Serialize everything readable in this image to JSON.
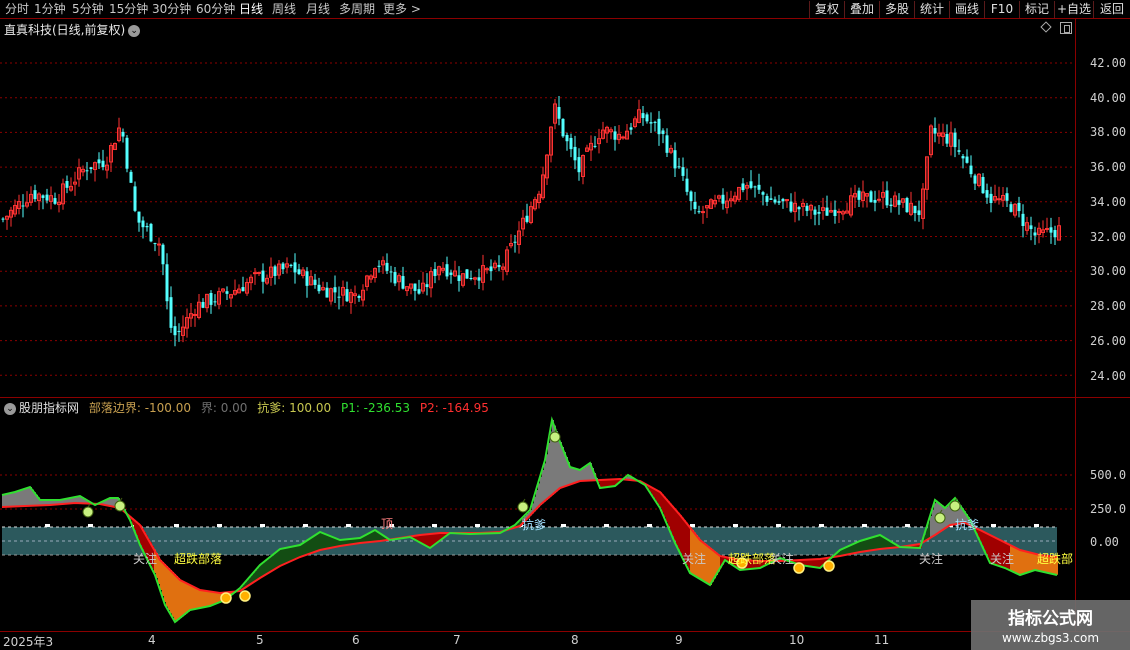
{
  "toolbar": {
    "periods": [
      "分时",
      "1分钟",
      "5分钟",
      "15分钟",
      "30分钟",
      "60分钟",
      "日线",
      "周线",
      "月线",
      "多周期",
      "更多 >"
    ],
    "active_period": "日线",
    "buttons": [
      "复权",
      "叠加",
      "多股",
      "统计",
      "画线",
      "F10",
      "标记",
      "+自选",
      "返回"
    ]
  },
  "stock": {
    "title": "直真科技(日线,前复权)"
  },
  "price_axis": [
    "42.00",
    "40.00",
    "38.00",
    "36.00",
    "34.00",
    "32.00",
    "30.00",
    "28.00",
    "26.00",
    "24.00"
  ],
  "indicator": {
    "name": "股朋指标网",
    "legend": [
      {
        "text": "部落边界: -100.00",
        "color": "#c8a050"
      },
      {
        "text": "界: 0.00",
        "color": "#707070"
      },
      {
        "text": "抗爹: 100.00",
        "color": "#c8c850"
      },
      {
        "text": "P1: -236.53",
        "color": "#30e030"
      },
      {
        "text": "P2: -164.95",
        "color": "#ff3030"
      }
    ],
    "axis": [
      "500.0",
      "250.0",
      "0.00"
    ],
    "annotations": [
      {
        "text": "关注",
        "color": "#ffffff"
      },
      {
        "text": "超跌部落",
        "color": "#ffff40"
      },
      {
        "text": "顶",
        "color": "#ff8080"
      },
      {
        "text": "抗爹",
        "color": "#a0e0ff"
      },
      {
        "text": "关注",
        "color": "#ffffff"
      },
      {
        "text": "超跌部落",
        "color": "#ffff40"
      },
      {
        "text": "关注",
        "color": "#ffffff"
      },
      {
        "text": "关注",
        "color": "#ffffff"
      },
      {
        "text": "抗爹",
        "color": "#a0e0ff"
      },
      {
        "text": "关注",
        "color": "#ffffff"
      },
      {
        "text": "超跌部",
        "color": "#ffff40"
      }
    ]
  },
  "date_axis": [
    "2025年",
    "3",
    "4",
    "5",
    "6",
    "7",
    "8",
    "9",
    "10",
    "11"
  ],
  "watermark": {
    "line1": "指标公式网",
    "line2": "www.zbgs3.com"
  },
  "colors": {
    "up": "#ff3232",
    "down": "#54ffff",
    "grid": "#8b0000",
    "p1": "#30e030",
    "p2": "#ff2020"
  }
}
